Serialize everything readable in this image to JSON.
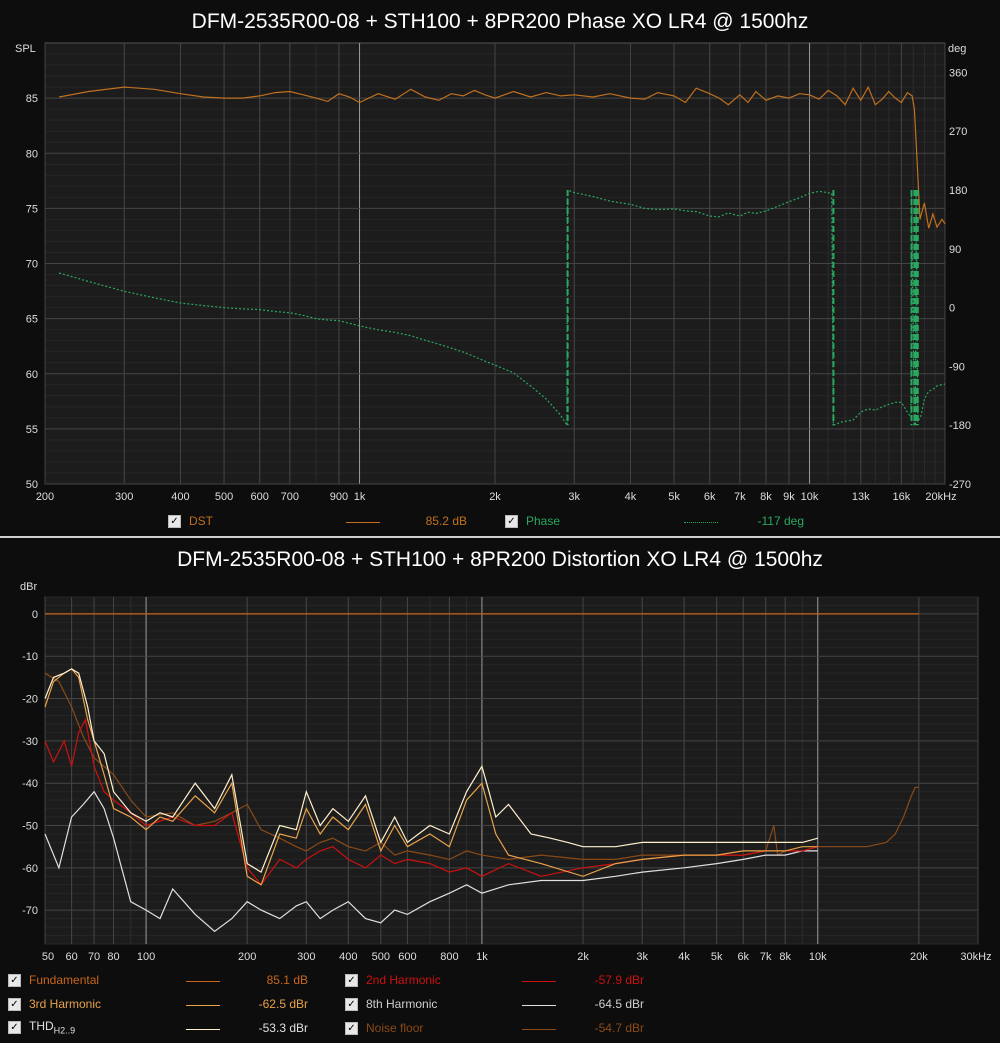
{
  "colors": {
    "dst": "#c0701f",
    "phase": "#2aa860",
    "fundamental": "#c8661c",
    "h2": "#cc1111",
    "h3": "#e8a24a",
    "h8": "#e0e0e0",
    "thd": "#fff0cc",
    "noise": "#8a4a18"
  },
  "chart_data": [
    {
      "type": "line",
      "title": "DFM-2535R00-08 + STH100 + 8PR200 Phase XO LR4 @ 1500hz",
      "ylabel": "SPL",
      "y2label": "deg",
      "xscale": "log",
      "xlim": [
        200,
        20000
      ],
      "ylim": [
        50,
        90
      ],
      "y2lim": [
        -270,
        405
      ],
      "grid": true,
      "x_ticks": [
        200,
        300,
        400,
        500,
        600,
        700,
        900,
        1000,
        2000,
        3000,
        4000,
        5000,
        6000,
        7000,
        8000,
        9000,
        10000,
        13000,
        16000,
        20000
      ],
      "x_tick_labels": [
        "200",
        "300",
        "400",
        "500",
        "600",
        "700",
        "900",
        "1k",
        "2k",
        "3k",
        "4k",
        "5k",
        "6k",
        "7k",
        "8k",
        "9k",
        "10k",
        "13k",
        "16k",
        "20kHz"
      ],
      "y_ticks": [
        50,
        55,
        60,
        65,
        70,
        75,
        80,
        85
      ],
      "y2_ticks": [
        -270,
        -180,
        -90,
        0,
        90,
        180,
        270,
        360
      ],
      "series": [
        {
          "name": "DST",
          "axis": "left",
          "x": [
            215,
            250,
            300,
            350,
            400,
            450,
            500,
            550,
            600,
            650,
            700,
            750,
            800,
            850,
            900,
            950,
            1000,
            1100,
            1200,
            1300,
            1400,
            1500,
            1600,
            1700,
            1800,
            1900,
            2000,
            2200,
            2400,
            2600,
            2800,
            3000,
            3300,
            3600,
            4000,
            4300,
            4600,
            5000,
            5300,
            5600,
            6000,
            6300,
            6600,
            7000,
            7300,
            7600,
            8000,
            8500,
            9000,
            9500,
            10000,
            10500,
            11000,
            11500,
            12000,
            12500,
            13000,
            13500,
            14000,
            14500,
            15000,
            15500,
            16000,
            16500,
            16900,
            17100,
            17300,
            17600,
            18000,
            18400,
            18800,
            19200,
            19700,
            20000
          ],
          "values": [
            85.1,
            85.6,
            86.0,
            85.8,
            85.4,
            85.1,
            85.0,
            85.0,
            85.2,
            85.5,
            85.6,
            85.3,
            85.0,
            84.7,
            85.4,
            85.1,
            84.6,
            85.4,
            84.9,
            85.8,
            85.1,
            84.8,
            85.4,
            85.2,
            85.7,
            85.3,
            85.0,
            85.6,
            85.1,
            85.5,
            85.2,
            85.3,
            85.1,
            85.4,
            85.0,
            84.9,
            85.5,
            85.2,
            84.6,
            85.9,
            85.4,
            85.0,
            84.4,
            85.3,
            84.6,
            85.6,
            84.8,
            85.2,
            85.0,
            85.4,
            85.3,
            84.9,
            85.7,
            85.2,
            84.4,
            85.9,
            84.8,
            86.0,
            84.4,
            84.9,
            85.6,
            85.0,
            84.6,
            85.5,
            85.2,
            84.0,
            80.0,
            74.0,
            75.5,
            73.2,
            74.5,
            73.3,
            74.0,
            73.6
          ]
        },
        {
          "name": "Phase",
          "axis": "right",
          "x": [
            215,
            250,
            300,
            350,
            400,
            450,
            500,
            550,
            600,
            650,
            700,
            750,
            800,
            850,
            900,
            950,
            1000,
            1100,
            1200,
            1300,
            1400,
            1500,
            1600,
            1700,
            1800,
            1900,
            2000,
            2200,
            2400,
            2600,
            2800,
            2890,
            2900,
            3000,
            3300,
            3600,
            4000,
            4300,
            4600,
            5000,
            5300,
            5600,
            6000,
            6300,
            6600,
            7000,
            7300,
            7600,
            8000,
            8500,
            9000,
            9500,
            10000,
            10500,
            11200,
            11300,
            11800,
            12500,
            13000,
            13500,
            14000,
            14500,
            15000,
            15500,
            16000,
            16500,
            16800,
            16850,
            17100,
            17200,
            17250,
            17400,
            17700,
            18000,
            18400,
            18800,
            19200,
            19700,
            20000
          ],
          "values": [
            53,
            40,
            25,
            15,
            7,
            3,
            0,
            -2,
            -3,
            -6,
            -8,
            -12,
            -17,
            -19,
            -20,
            -24,
            -28,
            -34,
            -38,
            -43,
            -50,
            -56,
            -62,
            -68,
            -75,
            -82,
            -88,
            -100,
            -120,
            -140,
            -165,
            -180,
            180,
            176,
            170,
            163,
            158,
            152,
            150,
            151,
            148,
            147,
            140,
            139,
            145,
            140,
            146,
            144,
            148,
            155,
            162,
            168,
            175,
            178,
            175,
            -180,
            -175,
            -172,
            -160,
            -155,
            -157,
            -152,
            -148,
            -145,
            -145,
            -160,
            -168,
            180,
            -180,
            -178,
            180,
            -175,
            -165,
            -140,
            -128,
            -125,
            -120,
            -118,
            -117
          ]
        }
      ],
      "legend": [
        {
          "name": "DST",
          "value": "85.2 dB"
        },
        {
          "name": "Phase",
          "value": "-117 deg"
        }
      ]
    },
    {
      "type": "line",
      "title": "DFM-2535R00-08 + STH100 + 8PR200 Distortion XO LR4 @ 1500hz",
      "ylabel": "dBr",
      "xscale": "log",
      "xlim": [
        50,
        30000
      ],
      "ylim": [
        -78,
        4
      ],
      "grid": true,
      "x_ticks": [
        50,
        60,
        70,
        80,
        100,
        200,
        300,
        400,
        500,
        600,
        800,
        1000,
        2000,
        3000,
        4000,
        5000,
        6000,
        7000,
        8000,
        10000,
        20000,
        30000
      ],
      "x_tick_labels": [
        "50",
        "60",
        "70",
        "80",
        "100",
        "200",
        "300",
        "400",
        "500",
        "600",
        "800",
        "1k",
        "2k",
        "3k",
        "4k",
        "5k",
        "6k",
        "7k",
        "8k",
        "10k",
        "20k",
        "30kHz"
      ],
      "y_ticks": [
        0,
        -10,
        -20,
        -30,
        -40,
        -50,
        -60,
        -70
      ],
      "series": [
        {
          "name": "Noise floor",
          "x": [
            50,
            55,
            60,
            65,
            70,
            80,
            90,
            100,
            120,
            140,
            160,
            180,
            200,
            220,
            250,
            280,
            300,
            330,
            360,
            400,
            450,
            500,
            550,
            600,
            700,
            800,
            900,
            1000,
            1200,
            1500,
            2000,
            2500,
            3000,
            4000,
            5000,
            6000,
            7000,
            7400,
            7600,
            8000,
            9000,
            10000,
            12000,
            14000,
            16000,
            17000,
            18000,
            19000,
            19500,
            20000
          ],
          "values": [
            -14,
            -16,
            -22,
            -29,
            -34,
            -38,
            -44,
            -48,
            -47,
            -50,
            -49,
            -47,
            -45,
            -51,
            -53,
            -55,
            -56,
            -54,
            -53,
            -55,
            -56,
            -54,
            -57,
            -56,
            -57,
            -58,
            -56,
            -57,
            -58,
            -57,
            -58,
            -58,
            -57,
            -57,
            -57,
            -57,
            -56,
            -50,
            -57,
            -56,
            -56,
            -55,
            -55,
            -55,
            -54,
            -52,
            -48,
            -43,
            -41,
            -41
          ]
        },
        {
          "name": "8th Harmonic",
          "x": [
            50,
            55,
            60,
            65,
            70,
            75,
            80,
            90,
            100,
            110,
            120,
            140,
            160,
            180,
            200,
            220,
            250,
            280,
            300,
            330,
            360,
            400,
            450,
            500,
            550,
            600,
            700,
            800,
            900,
            1000,
            1200,
            1500,
            2000,
            2500,
            3000,
            4000,
            5000,
            6000,
            7000,
            8000,
            9000,
            10000
          ],
          "values": [
            -52,
            -60,
            -48,
            -45,
            -42,
            -46,
            -53,
            -68,
            -70,
            -72,
            -65,
            -71,
            -75,
            -72,
            -68,
            -70,
            -72,
            -69,
            -68,
            -72,
            -70,
            -68,
            -72,
            -73,
            -70,
            -71,
            -68,
            -66,
            -64,
            -66,
            -64,
            -63,
            -63,
            -62,
            -61,
            -60,
            -59,
            -58,
            -57,
            -57,
            -56,
            -56
          ]
        },
        {
          "name": "2nd Harmonic",
          "x": [
            50,
            53,
            57,
            60,
            63,
            66,
            70,
            75,
            80,
            90,
            100,
            120,
            140,
            160,
            180,
            200,
            220,
            250,
            280,
            300,
            330,
            360,
            400,
            450,
            500,
            550,
            600,
            700,
            800,
            900,
            1000,
            1200,
            1500,
            2000,
            2500,
            3000,
            4000,
            5000,
            6000,
            7000,
            8000,
            9000,
            10000
          ],
          "values": [
            -30,
            -35,
            -30,
            -36,
            -28,
            -25,
            -36,
            -42,
            -44,
            -47,
            -50,
            -48,
            -50,
            -50,
            -47,
            -60,
            -64,
            -58,
            -60,
            -58,
            -56,
            -55,
            -58,
            -60,
            -57,
            -59,
            -58,
            -59,
            -61,
            -60,
            -62,
            -59,
            -62,
            -60,
            -59,
            -58,
            -57,
            -57,
            -57,
            -56,
            -56,
            -56,
            -55
          ]
        },
        {
          "name": "3rd Harmonic",
          "x": [
            50,
            53,
            57,
            60,
            63,
            67,
            70,
            75,
            80,
            90,
            100,
            110,
            120,
            140,
            160,
            180,
            200,
            220,
            250,
            280,
            300,
            330,
            360,
            400,
            450,
            500,
            550,
            600,
            700,
            800,
            900,
            1000,
            1100,
            1200,
            1500,
            2000,
            2500,
            3000,
            4000,
            5000,
            6000,
            7000,
            8000,
            9000,
            10000
          ],
          "values": [
            -22,
            -16,
            -14,
            -13,
            -15,
            -25,
            -30,
            -38,
            -46,
            -48,
            -51,
            -48,
            -49,
            -43,
            -47,
            -40,
            -62,
            -64,
            -52,
            -53,
            -46,
            -52,
            -48,
            -51,
            -45,
            -56,
            -50,
            -55,
            -52,
            -55,
            -44,
            -40,
            -52,
            -57,
            -59,
            -62,
            -59,
            -58,
            -57,
            -57,
            -56,
            -56,
            -56,
            -55,
            -55
          ]
        },
        {
          "name": "THD",
          "x": [
            50,
            53,
            57,
            60,
            63,
            67,
            70,
            75,
            80,
            90,
            100,
            110,
            120,
            140,
            160,
            180,
            200,
            220,
            250,
            280,
            300,
            330,
            360,
            400,
            450,
            500,
            550,
            600,
            700,
            800,
            900,
            1000,
            1050,
            1100,
            1200,
            1400,
            1600,
            1800,
            2000,
            2500,
            3000,
            4000,
            5000,
            6000,
            7000,
            8000,
            9000,
            10000
          ],
          "values": [
            -20,
            -15,
            -14,
            -13,
            -14,
            -22,
            -30,
            -33,
            -42,
            -47,
            -49,
            -47,
            -48,
            -40,
            -46,
            -38,
            -59,
            -61,
            -50,
            -51,
            -42,
            -50,
            -46,
            -49,
            -43,
            -54,
            -48,
            -54,
            -50,
            -52,
            -42,
            -36,
            -42,
            -48,
            -45,
            -52,
            -53,
            -54,
            -55,
            -55,
            -54,
            -54,
            -54,
            -54,
            -54,
            -54,
            -54,
            -53
          ]
        },
        {
          "name": "Fundamental",
          "x": [
            50,
            20000
          ],
          "values": [
            0,
            0
          ]
        }
      ],
      "legend": [
        {
          "name": "Fundamental",
          "value": "85.1 dB"
        },
        {
          "name": "2nd Harmonic",
          "value": "-57.9 dBr"
        },
        {
          "name": "3rd Harmonic",
          "value": "-62.5 dBr"
        },
        {
          "name": "8th Harmonic",
          "value": "-64.5 dBr"
        },
        {
          "name": "THD",
          "subscript": "H2..9",
          "value": "-53.3 dBr"
        },
        {
          "name": "Noise floor",
          "value": "-54.7 dBr"
        }
      ]
    }
  ]
}
